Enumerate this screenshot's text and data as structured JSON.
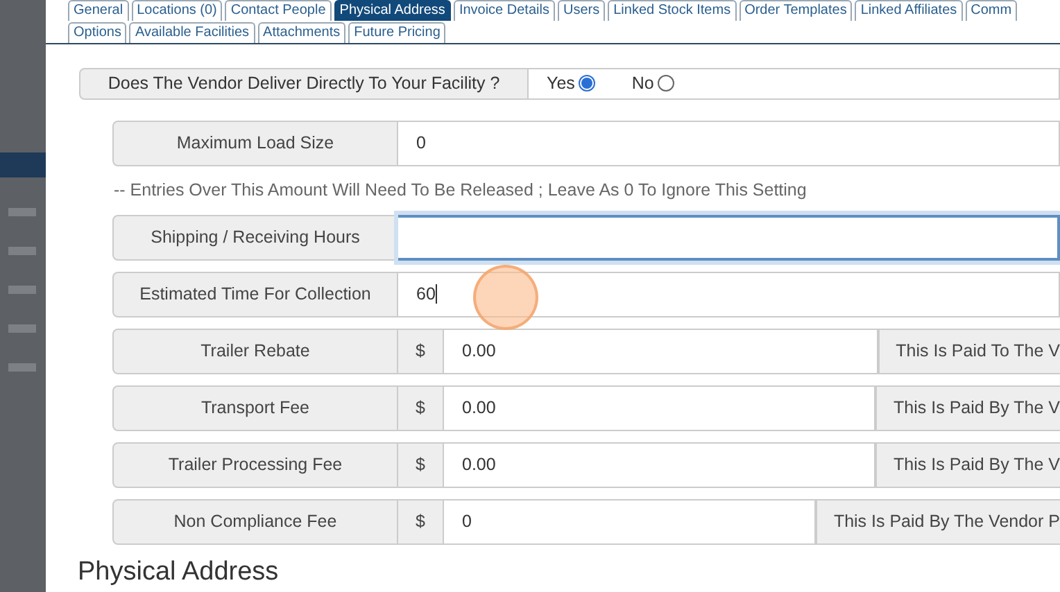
{
  "tabs_row_1": [
    {
      "label": "General",
      "selected": false
    },
    {
      "label": "Locations (0)",
      "selected": false
    },
    {
      "label": "Contact People",
      "selected": false
    },
    {
      "label": "Physical Address",
      "selected": true
    },
    {
      "label": "Invoice Details",
      "selected": false
    },
    {
      "label": "Users",
      "selected": false
    },
    {
      "label": "Linked Stock Items",
      "selected": false
    },
    {
      "label": "Order Templates",
      "selected": false
    },
    {
      "label": "Linked Affiliates",
      "selected": false
    },
    {
      "label": "Comm",
      "selected": false
    }
  ],
  "tabs_row_2": [
    {
      "label": "Options",
      "selected": false
    },
    {
      "label": "Available Facilities",
      "selected": false
    },
    {
      "label": "Attachments",
      "selected": false
    },
    {
      "label": "Future Pricing",
      "selected": false
    }
  ],
  "delivery_question": {
    "label": "Does The Vendor Deliver Directly To Your Facility ?",
    "options": [
      {
        "label": "Yes",
        "selected": true
      },
      {
        "label": "No",
        "selected": false
      }
    ]
  },
  "fields": [
    {
      "kind": "plain",
      "label": "Maximum Load Size",
      "value": "0",
      "focused": false
    },
    {
      "kind": "hint",
      "text": "-- Entries Over This Amount Will Need To Be Released ; Leave As 0 To Ignore This Setting"
    },
    {
      "kind": "plain",
      "label": "Shipping / Receiving Hours",
      "focused": true
    },
    {
      "kind": "plain",
      "label": "Estimated Time For Collection",
      "value": "60",
      "focused": false,
      "caret": true
    },
    {
      "kind": "money",
      "label": "Trailer Rebate",
      "currency": "$",
      "value": "0.00",
      "note": "This Is Paid To The V"
    },
    {
      "kind": "money",
      "label": "Transport Fee",
      "currency": "$",
      "value": "0.00",
      "note": "This Is Paid By The V"
    },
    {
      "kind": "money",
      "label": "Trailer Processing Fee",
      "currency": "$",
      "value": "0.00",
      "note": "This Is Paid By The V"
    },
    {
      "kind": "money",
      "label": "Non Compliance Fee",
      "currency": "$",
      "value": "0",
      "note": "This Is Paid By The Vendor P"
    }
  ],
  "section_heading": "Physical Address"
}
